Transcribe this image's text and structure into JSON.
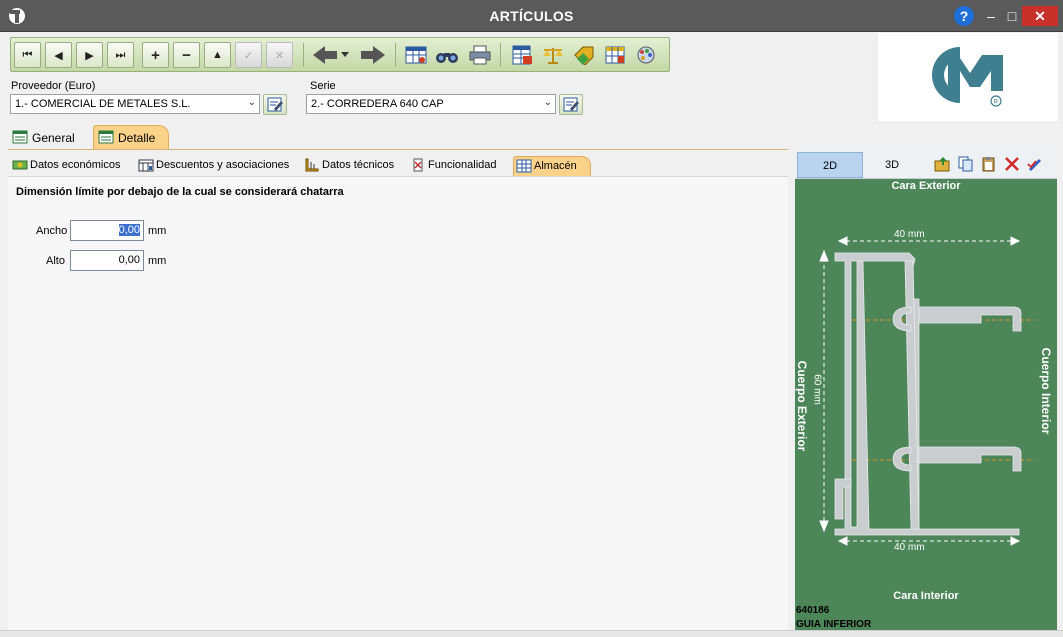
{
  "window": {
    "title": "ARTÍCULOS",
    "help": "?",
    "minimize": "–",
    "maximize": "□",
    "close": "✕"
  },
  "toolbar": {
    "buttons": [
      "first-record",
      "previous-record",
      "next-record",
      "last-record",
      "add-record",
      "delete-record",
      "edit-record",
      "confirm",
      "cancel",
      "back",
      "forward",
      "table-view",
      "search",
      "print",
      "spreadsheet",
      "scales",
      "tag",
      "grid",
      "palette"
    ]
  },
  "fields": {
    "proveedor_label": "Proveedor (Euro)",
    "proveedor_value": "1.- COMERCIAL DE METALES S.L.",
    "serie_label": "Serie",
    "serie_value": "2.- CORREDERA 640 CAP"
  },
  "tabs": {
    "general": "General",
    "detalle": "Detalle"
  },
  "subtabs": {
    "datos_economicos": "Datos económicos",
    "descuentos": "Descuentos y asociaciones",
    "datos_tecnicos": "Datos técnicos",
    "funcionalidad": "Funcionalidad",
    "almacen": "Almacén"
  },
  "almacen": {
    "section_title": "Dimensión límite por debajo de la cual se considerará chatarra",
    "ancho_label": "Ancho",
    "ancho_value": "0,00",
    "alto_label": "Alto",
    "alto_value": "0,00",
    "unit": "mm"
  },
  "drawing": {
    "tab_2d": "2D",
    "tab_3d": "3D",
    "cara_exterior": "Cara Exterior",
    "cara_interior": "Cara Interior",
    "cuerpo_exterior": "Cuerpo Exterior",
    "cuerpo_interior": "Cuerpo Interior",
    "dim_top": "40 mm",
    "dim_bottom": "40 mm",
    "dim_height": "60 mm",
    "code": "640186",
    "name": "GUIA INFERIOR"
  },
  "colors": {
    "toolbar": "#c3d8a6",
    "active_tab": "#fbd28a",
    "drawing_bg": "#4d8658",
    "profile": "#c9cdd0",
    "logo_teal": "#3f7f8f"
  }
}
